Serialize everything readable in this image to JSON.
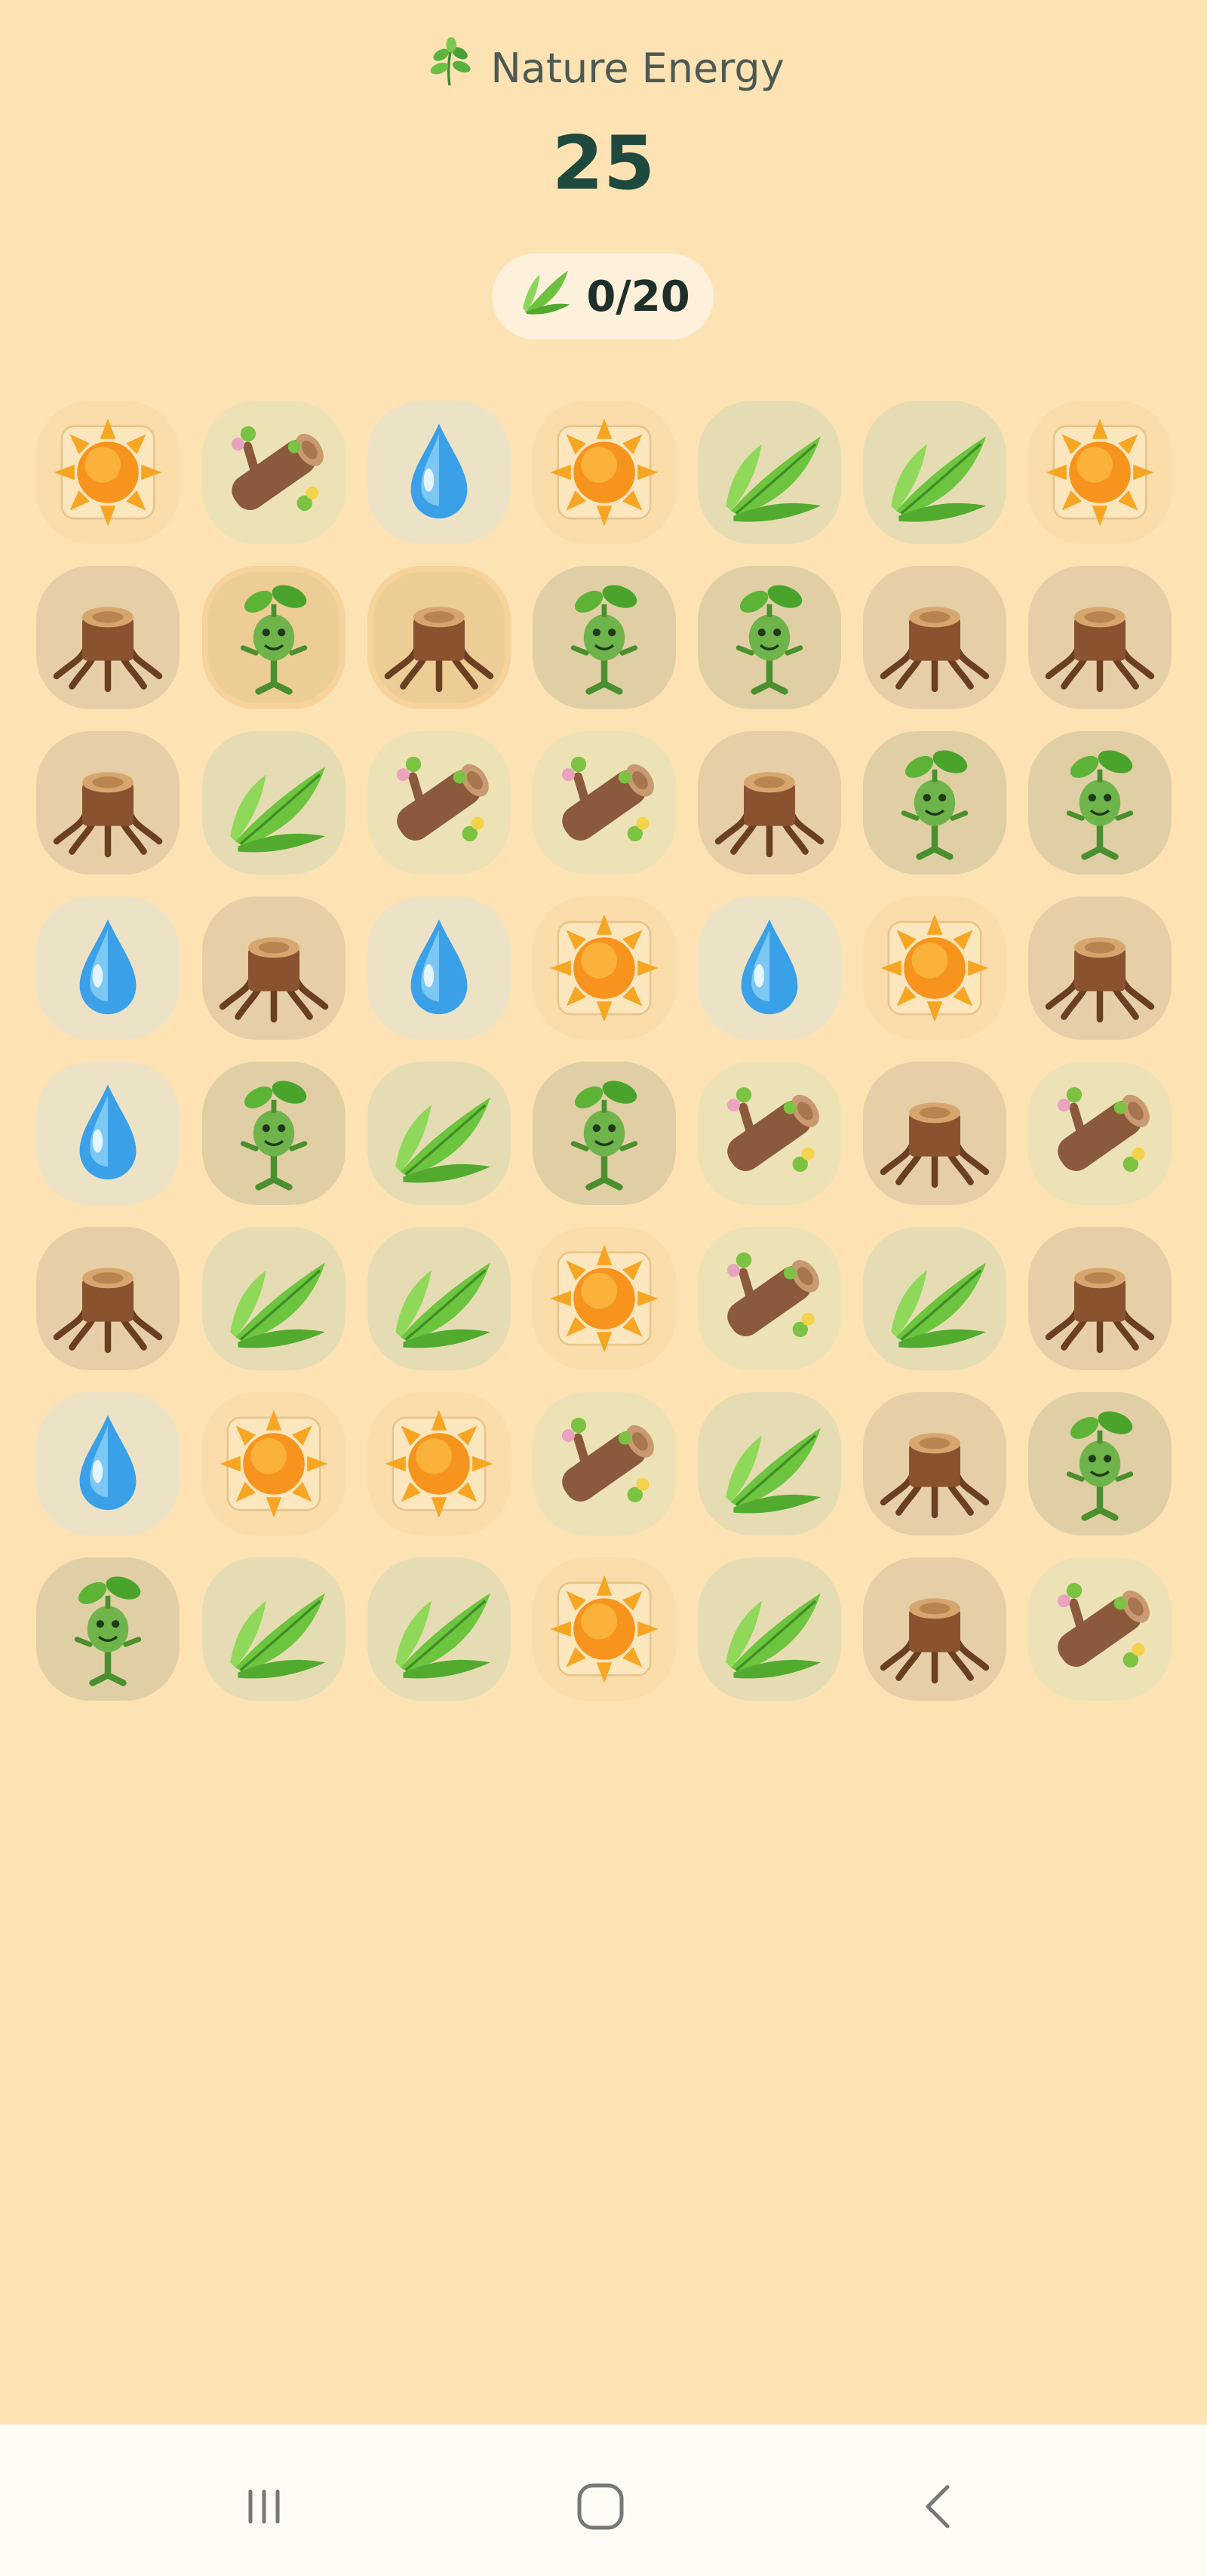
{
  "header": {
    "title": "Nature Energy",
    "title_icon": "leaf-sprig-icon",
    "score": "25",
    "goal": {
      "icon": "leaf-icon",
      "text": "0/20"
    }
  },
  "board": {
    "rows": 8,
    "cols": 7,
    "selected": [
      [
        1,
        1
      ],
      [
        1,
        2
      ]
    ],
    "tiles": [
      [
        "sun",
        "log",
        "drop",
        "sun",
        "leaf",
        "leaf",
        "sun"
      ],
      [
        "stump",
        "sprout",
        "stump",
        "sprout",
        "sprout",
        "stump",
        "stump"
      ],
      [
        "stump",
        "leaf",
        "log",
        "log",
        "stump",
        "sprout",
        "sprout"
      ],
      [
        "drop",
        "stump",
        "drop",
        "sun",
        "drop",
        "sun",
        "stump"
      ],
      [
        "drop",
        "sprout",
        "leaf",
        "sprout",
        "log",
        "stump",
        "log"
      ],
      [
        "stump",
        "leaf",
        "leaf",
        "sun",
        "log",
        "leaf",
        "stump"
      ],
      [
        "drop",
        "sun",
        "sun",
        "log",
        "leaf",
        "stump",
        "sprout"
      ],
      [
        "sprout",
        "leaf",
        "leaf",
        "sun",
        "leaf",
        "stump",
        "log"
      ]
    ]
  },
  "navbar": {
    "recent": "recent-apps-icon",
    "home": "home-icon",
    "back": "back-icon"
  }
}
